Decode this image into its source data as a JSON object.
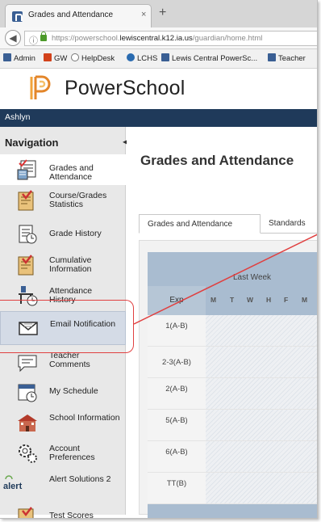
{
  "browser": {
    "tab_title": "Grades and Attendance",
    "tab_close": "×",
    "new_tab": "+",
    "url_prefix": "https://powerschool.",
    "url_domain": "lewiscentral.k12.ia.us",
    "url_path": "/guardian/home.html",
    "bookmarks": [
      {
        "label": "Admin",
        "icon": "powerschool-icon",
        "color": "#3a5f94"
      },
      {
        "label": "GW",
        "icon": "n-letter-icon",
        "color": "#d2421b"
      },
      {
        "label": "HelpDesk",
        "icon": "globe-icon",
        "color": "#777777"
      },
      {
        "label": "LCHS",
        "icon": "swirl-icon",
        "color": "#2a6bb0"
      },
      {
        "label": "Lewis Central PowerSc...",
        "icon": "powerschool-icon",
        "color": "#3a5f94"
      },
      {
        "label": "Teacher",
        "icon": "powerschool-icon",
        "color": "#3a5f94"
      }
    ]
  },
  "header": {
    "brand": "PowerSchool",
    "user": "Ashlyn"
  },
  "sidebar": {
    "heading": "Navigation",
    "items": [
      {
        "label": "Grades and Attendance",
        "icon": "grades-attendance-icon"
      },
      {
        "label": "Course/Grades Statistics",
        "icon": "course-statistics-icon"
      },
      {
        "label": "Grade History",
        "icon": "grade-history-icon"
      },
      {
        "label": "Cumulative Information",
        "icon": "cumulative-info-icon"
      },
      {
        "label": "Attendance History",
        "icon": "attendance-history-icon"
      },
      {
        "label": "Email Notification",
        "icon": "email-icon"
      },
      {
        "label": "Teacher Comments",
        "icon": "teacher-comments-icon"
      },
      {
        "label": "My Schedule",
        "icon": "schedule-icon"
      },
      {
        "label": "School Information",
        "icon": "school-icon"
      },
      {
        "label": "Account Preferences",
        "icon": "account-preferences-icon"
      },
      {
        "label": "Alert Solutions 2",
        "icon": "alert-icon"
      },
      {
        "label": "Test Scores",
        "icon": "test-scores-icon"
      }
    ]
  },
  "main": {
    "title": "Grades and Attendance",
    "tabs": [
      "Grades and Attendance",
      "Standards"
    ],
    "table": {
      "exp_header": "Exp",
      "week_header": "Last Week",
      "days": [
        "M",
        "T",
        "W",
        "H",
        "F",
        "M"
      ],
      "rows": [
        "1(A-B)",
        "2-3(A-B)",
        "2(A-B)",
        "5(A-B)",
        "6(A-B)",
        "TT(B)"
      ]
    }
  },
  "colors": {
    "header_bar": "#1f3a5a",
    "highlight": "#e04040",
    "table_header": "#a9bcd0"
  }
}
